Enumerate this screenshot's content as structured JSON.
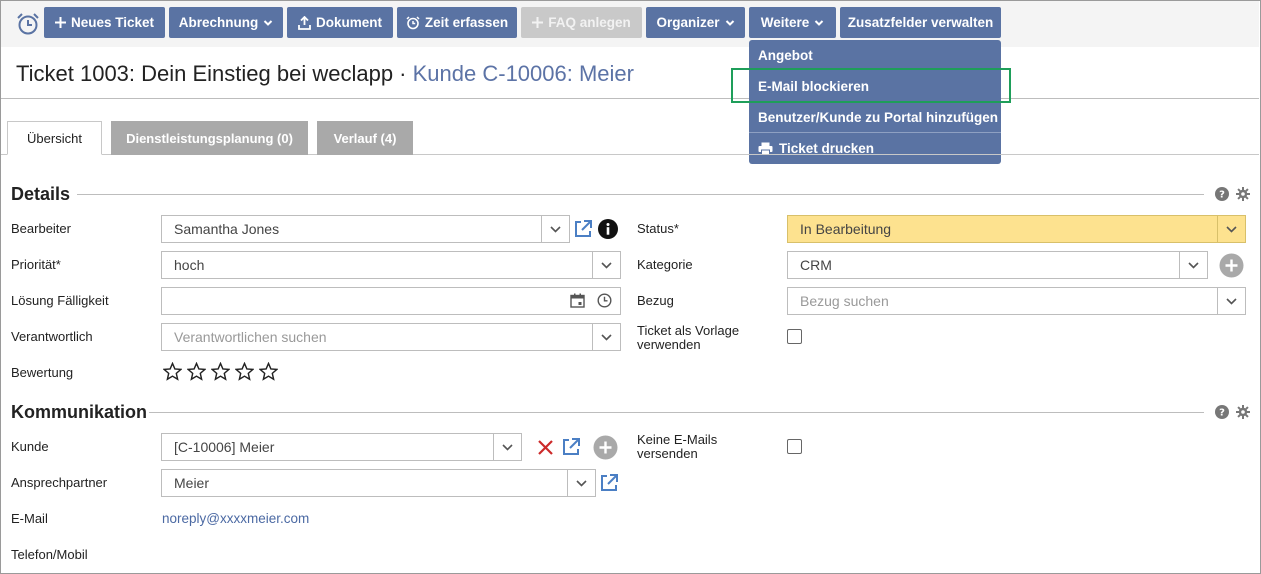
{
  "toolbar": {
    "buttons": {
      "new_ticket": "Neues Ticket",
      "billing": "Abrechnung",
      "document": "Dokument",
      "time": "Zeit erfassen",
      "faq": "FAQ anlegen",
      "organizer": "Organizer",
      "more": "Weitere",
      "custom_fields": "Zusatzfelder verwalten"
    },
    "accent_color": "#5a73a3",
    "disabled_color": "#c9c9c9"
  },
  "more_menu": {
    "items": [
      "Angebot",
      "E-Mail blockieren",
      "Benutzer/Kunde zu Portal hinzufügen",
      "Ticket drucken"
    ],
    "highlighted": "E-Mail blockieren",
    "highlight_color": "#1e9e5a"
  },
  "page": {
    "title": "Ticket 1003: Dein Einstieg bei weclapp",
    "separator": " · ",
    "customer_link": "Kunde C-10006: Meier"
  },
  "tabs": [
    "Übersicht",
    "Dienstleistungsplanung (0)",
    "Verlauf (4)"
  ],
  "details": {
    "heading": "Details",
    "bearbeiter": {
      "label": "Bearbeiter",
      "value": "Samantha Jones"
    },
    "prioritaet": {
      "label": "Priorität*",
      "value": "hoch"
    },
    "faelligkeit": {
      "label": "Lösung Fälligkeit",
      "value": ""
    },
    "verantwortlich": {
      "label": "Verantwortlich",
      "placeholder": "Verantwortlichen suchen"
    },
    "bewertung": {
      "label": "Bewertung",
      "stars": 0,
      "max": 5
    },
    "status": {
      "label": "Status*",
      "value": "In Bearbeitung",
      "color": "#fde28f"
    },
    "kategorie": {
      "label": "Kategorie",
      "value": "CRM"
    },
    "bezug": {
      "label": "Bezug",
      "placeholder": "Bezug suchen"
    },
    "vorlage": {
      "label_line1": "Ticket als Vorlage",
      "label_line2": "verwenden",
      "checked": false
    }
  },
  "kommunikation": {
    "heading": "Kommunikation",
    "kunde": {
      "label": "Kunde",
      "value": "[C-10006] Meier"
    },
    "ansprechpartner": {
      "label": "Ansprechpartner",
      "value": "Meier"
    },
    "email": {
      "label": "E-Mail",
      "value": "noreply@xxxxmeier.com"
    },
    "telefon": {
      "label": "Telefon/Mobil",
      "value": ""
    },
    "keine_emails": {
      "label_line1": "Keine E-Mails",
      "label_line2": "versenden",
      "checked": false
    }
  }
}
